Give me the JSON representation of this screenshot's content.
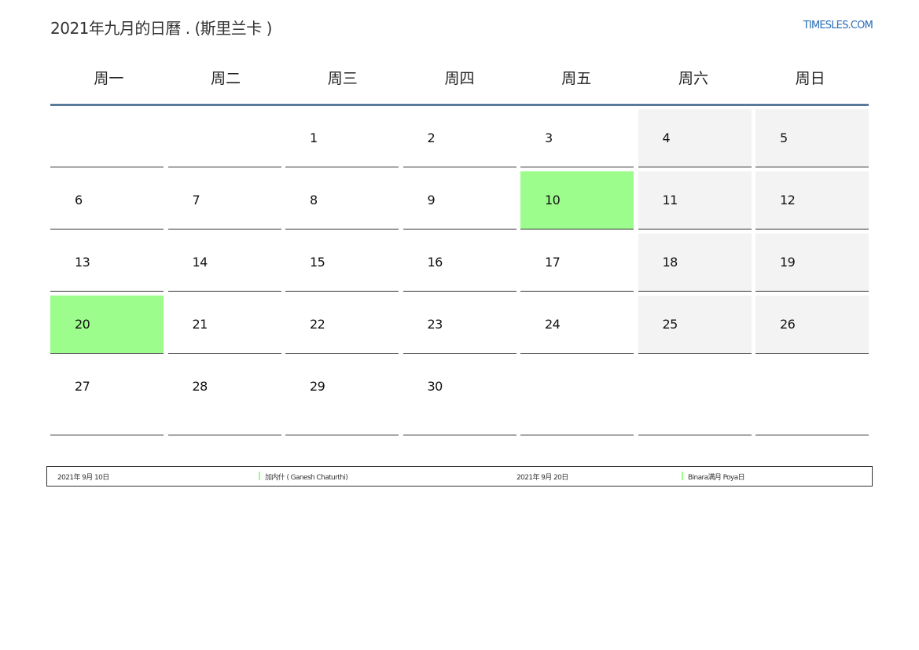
{
  "header": {
    "title": "2021年九月的日曆 . (斯里兰卡 )",
    "site": "TIMESLES.COM"
  },
  "weekdays": [
    "周一",
    "周二",
    "周三",
    "周四",
    "周五",
    "周六",
    "周日"
  ],
  "weeks": [
    [
      "",
      "",
      "1",
      "2",
      "3",
      "4",
      "5"
    ],
    [
      "6",
      "7",
      "8",
      "9",
      "10",
      "11",
      "12"
    ],
    [
      "13",
      "14",
      "15",
      "16",
      "17",
      "18",
      "19"
    ],
    [
      "20",
      "21",
      "22",
      "23",
      "24",
      "25",
      "26"
    ],
    [
      "27",
      "28",
      "29",
      "30",
      "",
      "",
      ""
    ]
  ],
  "holidays": [
    "10",
    "20"
  ],
  "colors": {
    "holiday": "#9cfc8c",
    "weekend": "#f3f3f3",
    "header_rule": "#5a7a9c",
    "link": "#2a6db5"
  },
  "legend": [
    {
      "date": "2021年 9月 10日",
      "name": "加内什 ( Ganesh Chaturthi)"
    },
    {
      "date": "2021年 9月 20日",
      "name": "Binara满月 Poya日"
    }
  ]
}
